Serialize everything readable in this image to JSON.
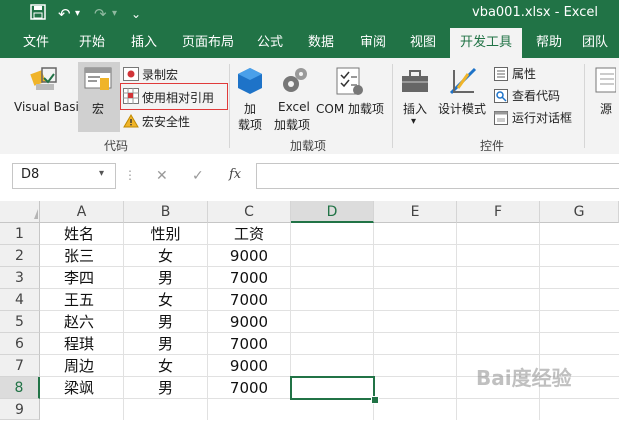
{
  "app": {
    "title": "vba001.xlsx  -  Excel"
  },
  "quick_access": {
    "save_icon": "save-icon",
    "undo_glyph": "↶",
    "redo_glyph": "↷",
    "more_glyph": "⌄"
  },
  "tabs": [
    "文件",
    "开始",
    "插入",
    "页面布局",
    "公式",
    "数据",
    "审阅",
    "视图",
    "开发工具",
    "帮助",
    "团队"
  ],
  "active_tab": "开发工具",
  "ribbon": {
    "code_group": {
      "label": "代码",
      "visual_basic": "Visual Basic",
      "macros": "宏",
      "record_macro": "录制宏",
      "use_relative_refs": "使用相对引用",
      "macro_security": "宏安全性"
    },
    "addins_group": {
      "label": "加载项",
      "addins": "加\n载项",
      "addins_line1": "加",
      "addins_line2": "载项",
      "excel_addins_line1": "Excel",
      "excel_addins_line2": "加载项",
      "com_addins": "COM 加载项"
    },
    "controls_group": {
      "label": "控件",
      "insert": "插入",
      "insert_arrow": "▾",
      "design_mode": "设计模式",
      "properties": "属性",
      "view_code": "查看代码",
      "run_dialog": "运行对话框"
    },
    "source_partial": "源"
  },
  "formula_bar": {
    "name_box": "D8",
    "cancel_glyph": "✕",
    "enter_glyph": "✓",
    "fx_glyph": "fx",
    "content": ""
  },
  "sheet": {
    "columns": [
      "A",
      "B",
      "C",
      "D",
      "E",
      "F",
      "G"
    ],
    "rows": [
      "1",
      "2",
      "3",
      "4",
      "5",
      "6",
      "7",
      "8",
      "9"
    ],
    "selected_cell": "D8",
    "data": [
      [
        "姓名",
        "性别",
        "工资"
      ],
      [
        "张三",
        "女",
        "9000"
      ],
      [
        "李四",
        "男",
        "7000"
      ],
      [
        "王五",
        "女",
        "7000"
      ],
      [
        "赵六",
        "男",
        "9000"
      ],
      [
        "程琪",
        "男",
        "7000"
      ],
      [
        "周边",
        "女",
        "9000"
      ],
      [
        "梁飒",
        "男",
        "7000"
      ],
      [
        "",
        "",
        ""
      ]
    ]
  },
  "watermark": "Bai度经验"
}
